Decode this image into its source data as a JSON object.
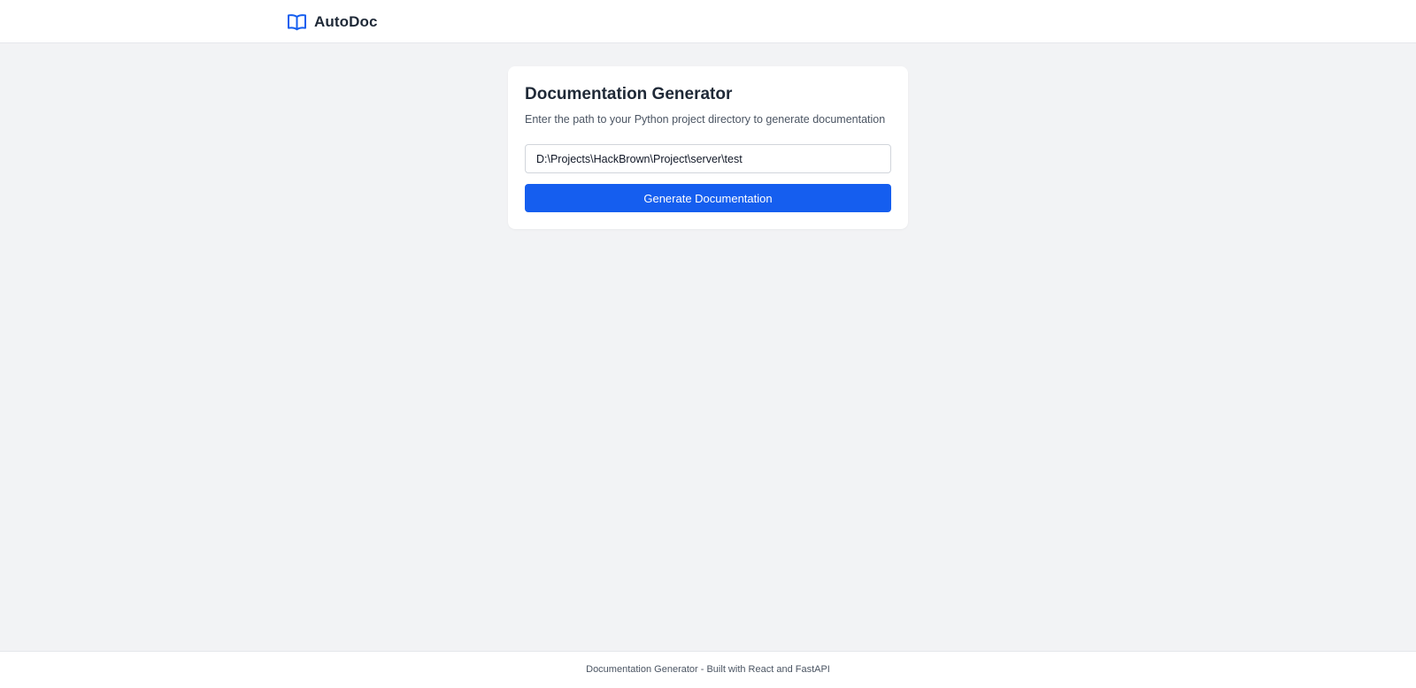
{
  "navbar": {
    "brand_name": "AutoDoc",
    "brand_icon": "book-open-icon",
    "brand_color": "#155eef"
  },
  "card": {
    "title": "Documentation Generator",
    "subtitle": "Enter the path to your Python project directory to generate documentation",
    "path_input": {
      "value": "D:\\Projects\\HackBrown\\Project\\server\\test",
      "placeholder": ""
    },
    "generate_button_label": "Generate Documentation",
    "button_color": "#155eef"
  },
  "footer": {
    "text": "Documentation Generator - Built with React and FastAPI"
  }
}
